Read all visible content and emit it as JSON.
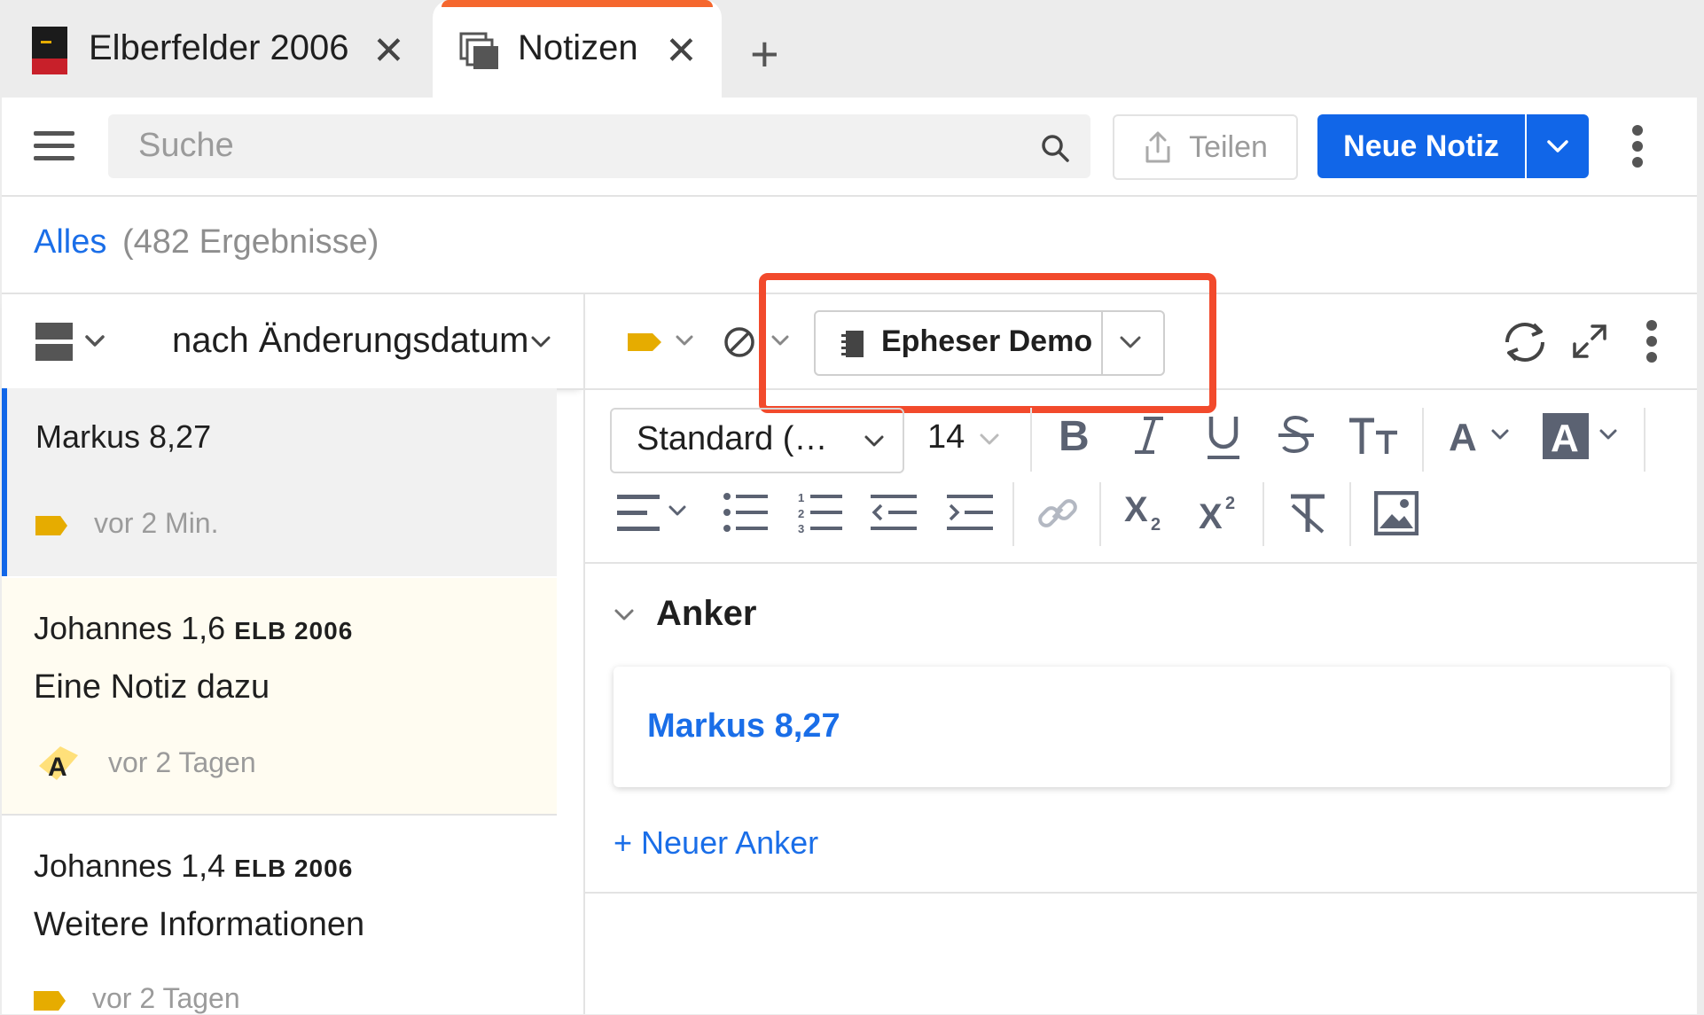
{
  "tabs": [
    {
      "label": "Elberfelder 2006",
      "close": "✕",
      "icon": "bible-book-icon",
      "active": false
    },
    {
      "label": "Notizen",
      "close": "✕",
      "icon": "notes-stack-icon",
      "active": true
    }
  ],
  "new_tab": "+",
  "search": {
    "placeholder": "Suche"
  },
  "share_label": "Teilen",
  "new_note_label": "Neue Notiz",
  "filter": {
    "all_label": "Alles",
    "count_label": "(482 Ergebnisse)"
  },
  "sort_label": "nach Änderungsdatum",
  "notes": [
    {
      "ref": "Markus 8,27",
      "ref_suffix": "",
      "title": "",
      "time": "vor 2 Min.",
      "tag": "yellow-tag"
    },
    {
      "ref": "Johannes 1,6",
      "ref_suffix": "ELB 2006",
      "title": "Eine Notiz dazu",
      "time": "vor 2 Tagen",
      "tag": "highlight-a"
    },
    {
      "ref": "Johannes 1,4",
      "ref_suffix": "ELB 2006",
      "title": "Weitere Informationen",
      "time": "vor 2 Tagen",
      "tag": "yellow-tag"
    }
  ],
  "notebook_label": "Epheser Demo",
  "format": {
    "font": "Standard (…",
    "size": "14"
  },
  "anchor": {
    "heading": "Anker",
    "link": "Markus 8,27",
    "new_anchor": "+ Neuer Anker"
  },
  "colors": {
    "accent": "#1166e8",
    "tab_indicator": "#f5672e",
    "highlight_box": "#f24a2c",
    "tag_yellow": "#e6ac00"
  }
}
